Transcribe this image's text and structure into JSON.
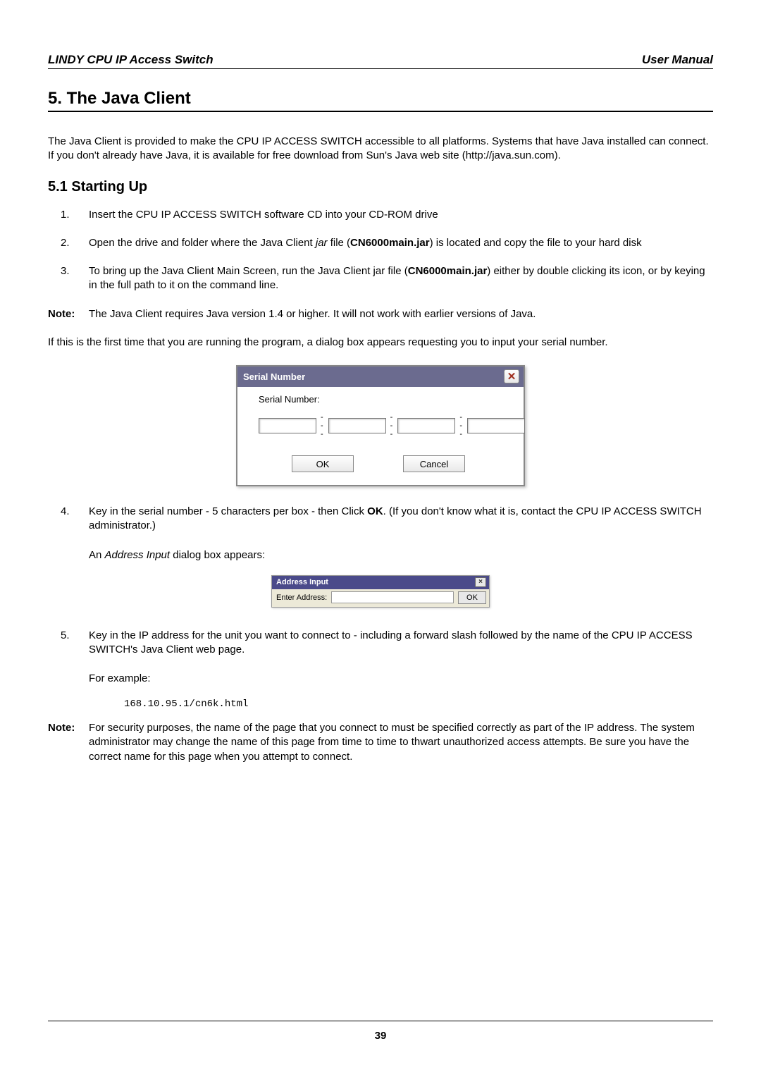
{
  "header": {
    "left": "LINDY CPU IP Access Switch",
    "right": "User Manual"
  },
  "section": {
    "title": "5. The Java Client",
    "intro": "The Java Client is provided to make the CPU IP ACCESS SWITCH accessible to all platforms. Systems that have Java installed can connect. If you don't already have Java, it is available for free download from Sun's Java web site (http://java.sun.com).",
    "subsection_title": "5.1 Starting Up",
    "step1": "Insert the CPU IP ACCESS SWITCH software CD into your CD-ROM drive",
    "step2_a": "Open the drive and folder where the Java Client ",
    "step2_jar": "jar",
    "step2_b": " file (",
    "step2_file": "CN6000main.jar",
    "step2_c": ") is located and copy the file to your hard disk",
    "step3_a": "To bring up the Java Client Main Screen, run the Java Client jar file (",
    "step3_file": "CN6000main.jar",
    "step3_b": ") either by double clicking its icon, or by keying in the full path to it on the command line.",
    "note1_label": "Note:",
    "note1_body": "The Java Client requires Java version 1.4 or higher. It will not work with earlier versions of Java.",
    "para_after_note1": "If this is the first time that you are running the program, a dialog box appears requesting you to input your serial number.",
    "step4_a": "Key in the serial number - 5 characters per box - then Click ",
    "step4_ok": "OK",
    "step4_b": ". (If you don't know what it is, contact the CPU IP ACCESS SWITCH administrator.)",
    "step4_sub_a": "An ",
    "step4_sub_i": "Address Input",
    "step4_sub_b": " dialog box appears:",
    "step5": "Key in the IP address for the unit you want to connect to - including a forward slash followed by the name of the CPU IP ACCESS SWITCH's Java Client web page.",
    "step5_sub": "For example:",
    "code": "168.10.95.1/cn6k.html",
    "note2_label": "Note:",
    "note2_body": "For security purposes, the name of the page that you connect to must be specified correctly as part of the IP address. The system administrator may change the name of this page from time to time to thwart unauthorized access attempts. Be sure you have the correct name for this page when you attempt to connect."
  },
  "serial_dialog": {
    "title": "Serial Number",
    "label": "Serial Number:",
    "ok": "OK",
    "cancel": "Cancel"
  },
  "addr_dialog": {
    "title": "Address Input",
    "label": "Enter Address:",
    "ok": "OK"
  },
  "footer": {
    "page": "39"
  }
}
